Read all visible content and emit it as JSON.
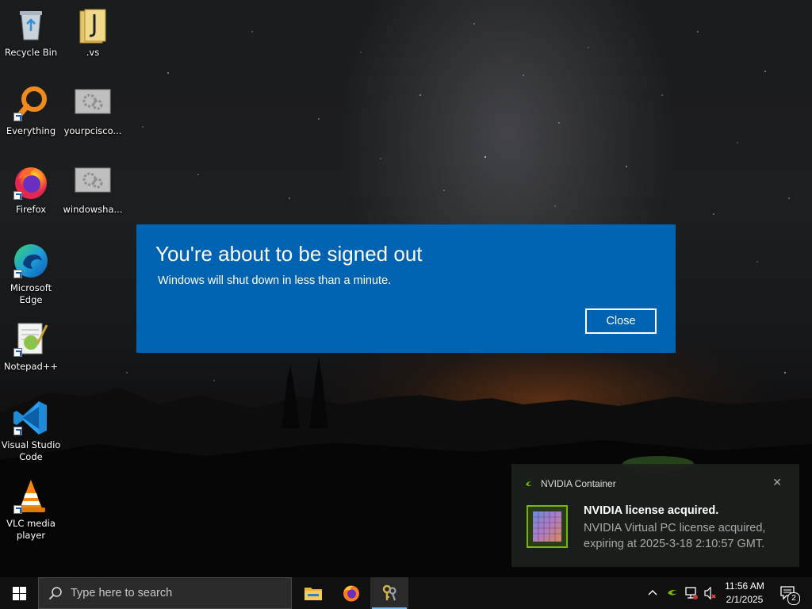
{
  "desktop": {
    "icons": [
      {
        "label": "Recycle Bin",
        "icon": "recycle-bin-icon"
      },
      {
        "label": ".vs",
        "icon": "folder-icon"
      },
      {
        "label": "Everything",
        "icon": "everything-search-icon"
      },
      {
        "label": "yourpcisco...",
        "icon": "gear-image-icon"
      },
      {
        "label": "Firefox",
        "icon": "firefox-icon"
      },
      {
        "label": "windowsha...",
        "icon": "gear-image-icon"
      },
      {
        "label": "Microsoft Edge",
        "icon": "edge-icon"
      },
      {
        "label": "Notepad++",
        "icon": "notepad-plus-plus-icon"
      },
      {
        "label": "Visual Studio Code",
        "icon": "vscode-icon"
      },
      {
        "label": "VLC media player",
        "icon": "vlc-icon"
      }
    ]
  },
  "dialog": {
    "title": "You're about to be signed out",
    "message": "Windows will shut down in less than a minute.",
    "close_label": "Close",
    "bg_color": "#0063b1"
  },
  "toast": {
    "app": "NVIDIA Container",
    "title": "NVIDIA license acquired.",
    "body": "NVIDIA Virtual PC license acquired, expiring at 2025-3-18 2:10:57 GMT.",
    "close_glyph": "✕"
  },
  "taskbar": {
    "search_placeholder": "Type here to search",
    "apps": [
      {
        "name": "File Explorer",
        "icon": "file-explorer-icon"
      },
      {
        "name": "Firefox",
        "icon": "firefox-icon"
      },
      {
        "name": "Keys app",
        "icon": "keys-icon"
      }
    ],
    "time": "11:56 AM",
    "date": "2/1/2025",
    "notification_count": "2",
    "accent_color": "#76b9ed"
  }
}
